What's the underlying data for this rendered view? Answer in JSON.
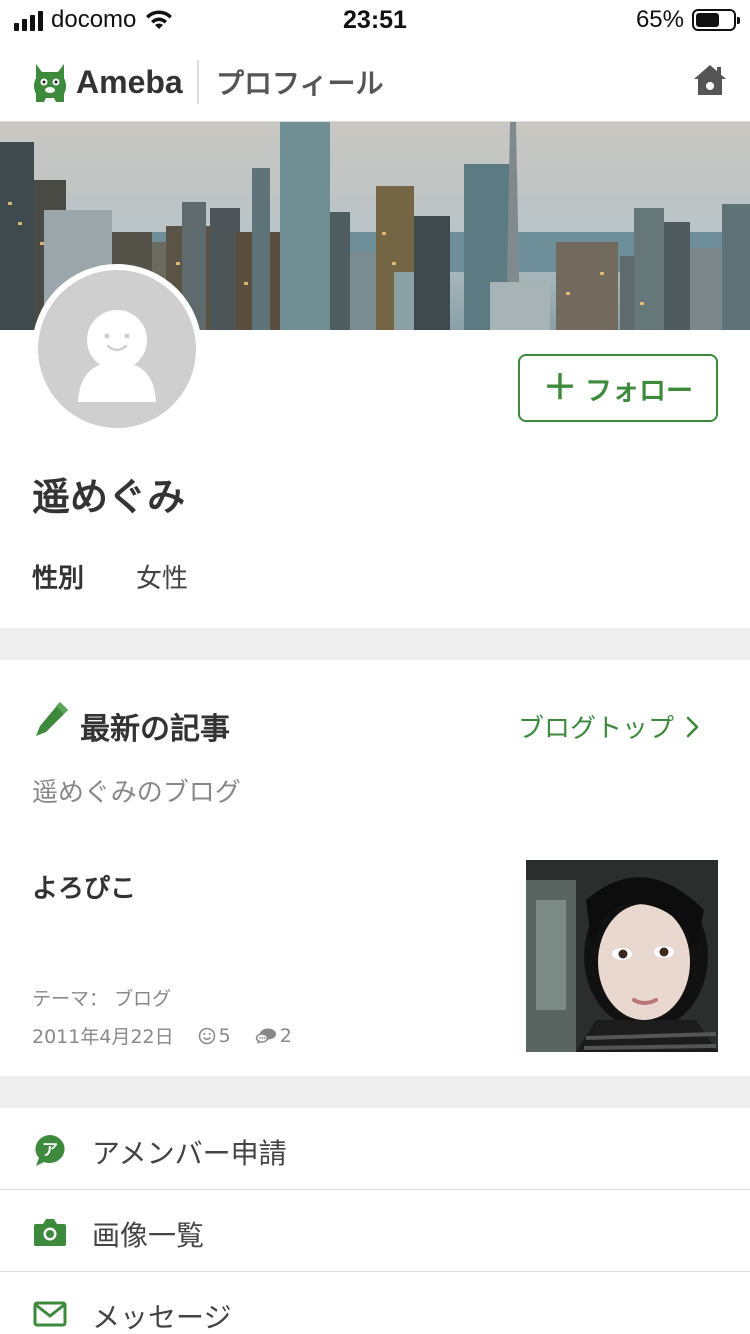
{
  "status_bar": {
    "carrier": "docomo",
    "time": "23:51",
    "battery_percent": "65%",
    "battery_level": 0.65
  },
  "header": {
    "logo_text": "Ameba",
    "title": "プロフィール"
  },
  "profile": {
    "follow_label": "フォロー",
    "name": "遥めぐみ",
    "gender_label": "性別",
    "gender_value": "女性"
  },
  "latest": {
    "title": "最新の記事",
    "blog_top_label": "ブログトップ",
    "blog_name": "遥めぐみのブログ",
    "article": {
      "title": "よろぴこ",
      "theme": "テーマ： ブログ",
      "date": "2011年4月22日",
      "likes": "5",
      "comments": "2"
    }
  },
  "menu": {
    "items": [
      {
        "label": "アメンバー申請",
        "icon": "amember-icon"
      },
      {
        "label": "画像一覧",
        "icon": "camera-icon"
      },
      {
        "label": "メッセージ",
        "icon": "mail-icon"
      }
    ]
  },
  "colors": {
    "accent": "#3d8a3d",
    "separator": "#eeeeee"
  }
}
